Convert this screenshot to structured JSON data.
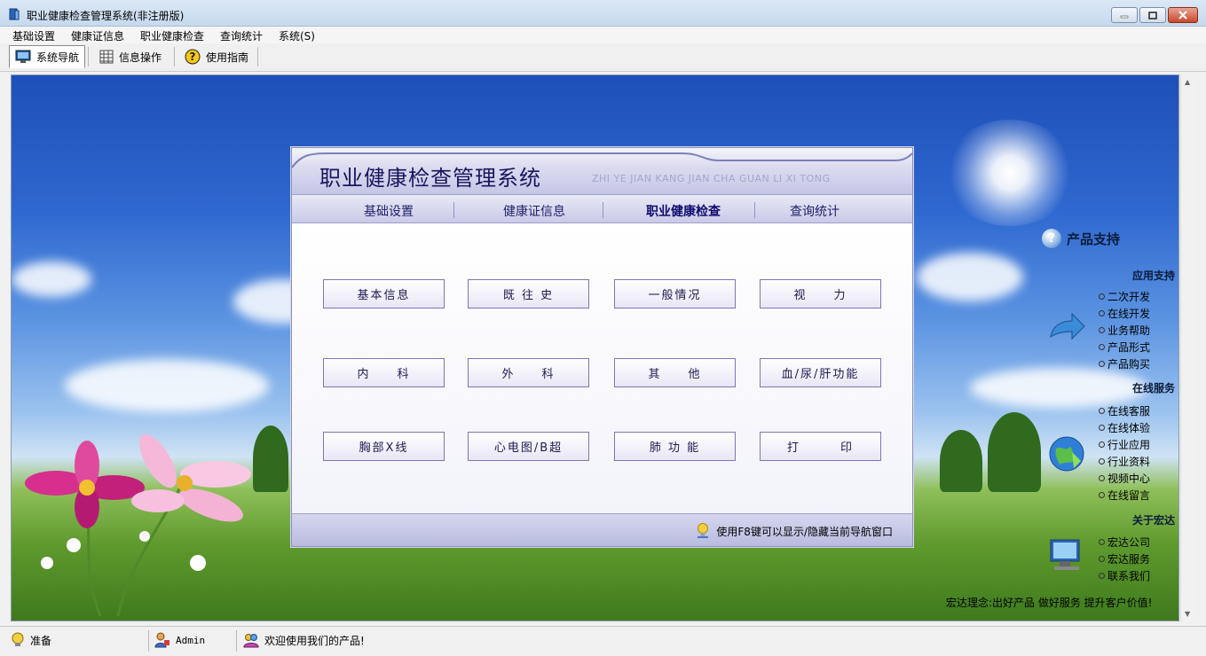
{
  "window": {
    "title": "职业健康检查管理系统(非注册版)"
  },
  "menu": [
    "基础设置",
    "健康证信息",
    "职业健康检查",
    "查询统计",
    "系统(S)"
  ],
  "toolbar": {
    "items": [
      {
        "label": "系统导航",
        "icon": "monitor-icon"
      },
      {
        "label": "信息操作",
        "icon": "grid-icon"
      },
      {
        "label": "使用指南",
        "icon": "help-icon"
      }
    ]
  },
  "dialog": {
    "title": "职业健康检查管理系统",
    "pinyin": "ZHI YE JIAN KANG JIAN CHA GUAN LI XI TONG",
    "tabs": [
      "基础设置",
      "健康证信息",
      "职业健康检查",
      "查询统计"
    ],
    "active_tab": 2,
    "buttons": [
      "基本信息",
      "既 往 史",
      "一般情况",
      "视　　力",
      "内　　科",
      "外　　科",
      "其　　他",
      "血/尿/肝功能",
      "胸部X线",
      "心电图/B超",
      "肺 功 能",
      "打　　　印"
    ],
    "tip": "使用F8键可以显示/隐藏当前导航窗口"
  },
  "support": {
    "heading": "产品支持",
    "sections": [
      {
        "title": "应用支持",
        "links": [
          "二次开发",
          "在线开发",
          "业务帮助",
          "产品形式",
          "产品购买"
        ]
      },
      {
        "title": "在线服务",
        "links": [
          "在线客服",
          "在线体验",
          "行业应用",
          "行业资料",
          "视频中心",
          "在线留言"
        ]
      },
      {
        "title": "关于宏达",
        "links": [
          "宏达公司",
          "宏达服务",
          "联系我们"
        ]
      }
    ],
    "motto": "宏达理念:出好产品  做好服务  提升客户价值!"
  },
  "status": {
    "ready": "准备",
    "user": "Admin",
    "welcome": "欢迎使用我们的产品!"
  }
}
